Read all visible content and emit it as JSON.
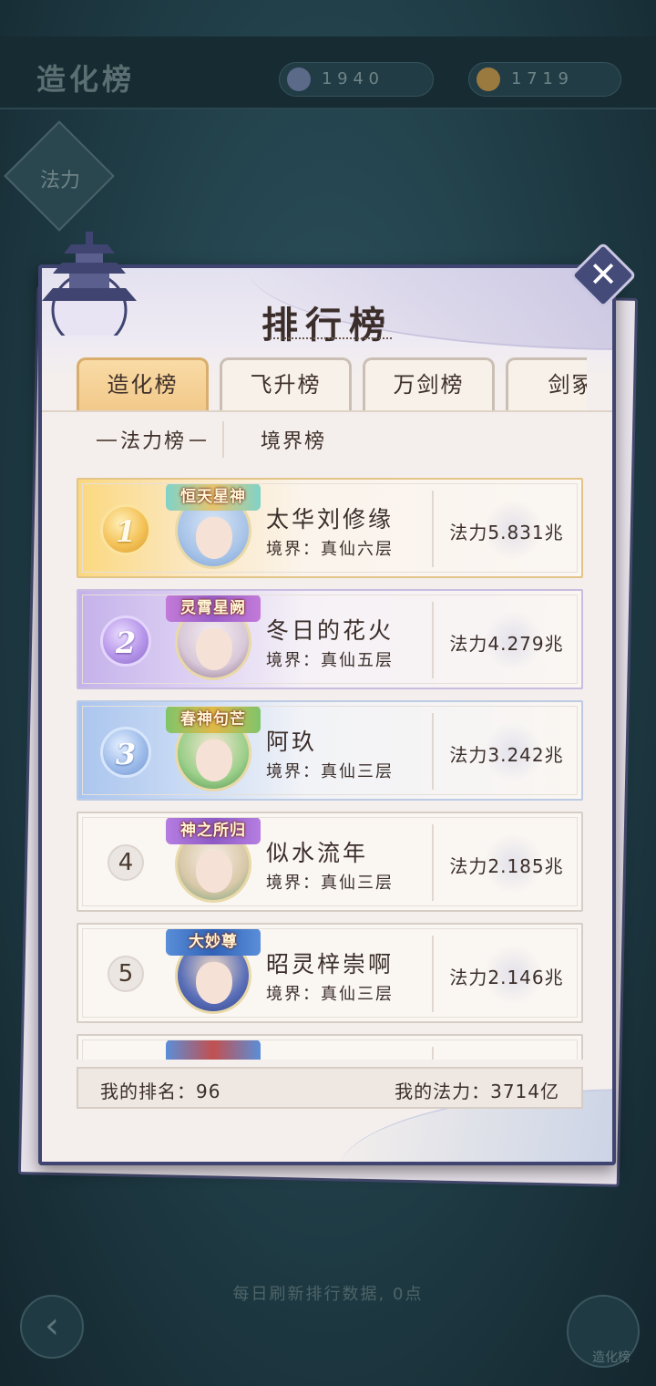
{
  "background": {
    "title": "造化榜",
    "resource_1": "1 9 4 0",
    "resource_2": "1 7 1 9",
    "side_button": "法力",
    "hint": "每日刷新排行数据, 0点",
    "corner_label": "造化榜"
  },
  "panel": {
    "title": "排行榜",
    "tabs": [
      {
        "label": "造化榜",
        "active": true
      },
      {
        "label": "飞升榜",
        "active": false
      },
      {
        "label": "万剑榜",
        "active": false
      },
      {
        "label": "剑冢",
        "active": false
      }
    ],
    "subtabs": [
      {
        "label": "法力榜",
        "active": true
      },
      {
        "label": "境界榜",
        "active": false
      }
    ],
    "rows": [
      {
        "rank": "1",
        "badge": "恒天星神",
        "name": "太华刘修缘",
        "realm": "境界：真仙六层",
        "power": "法力5.831兆"
      },
      {
        "rank": "2",
        "badge": "灵霄星阙",
        "name": "冬日的花火",
        "realm": "境界：真仙五层",
        "power": "法力4.279兆"
      },
      {
        "rank": "3",
        "badge": "春神句芒",
        "name": "阿玖",
        "realm": "境界：真仙三层",
        "power": "法力3.242兆"
      },
      {
        "rank": "4",
        "badge": "神之所归",
        "name": "似水流年",
        "realm": "境界：真仙三层",
        "power": "法力2.185兆"
      },
      {
        "rank": "5",
        "badge": "大妙尊",
        "name": "昭灵梓崇啊",
        "realm": "境界：真仙三层",
        "power": "法力2.146兆"
      }
    ],
    "footer": {
      "my_rank": "我的排名：96",
      "my_power": "我的法力：3714亿"
    }
  },
  "colors": {
    "panel_border": "#3f4470",
    "gold": "#f4c35a",
    "purple": "#b797ea",
    "blue": "#9fbdea"
  }
}
